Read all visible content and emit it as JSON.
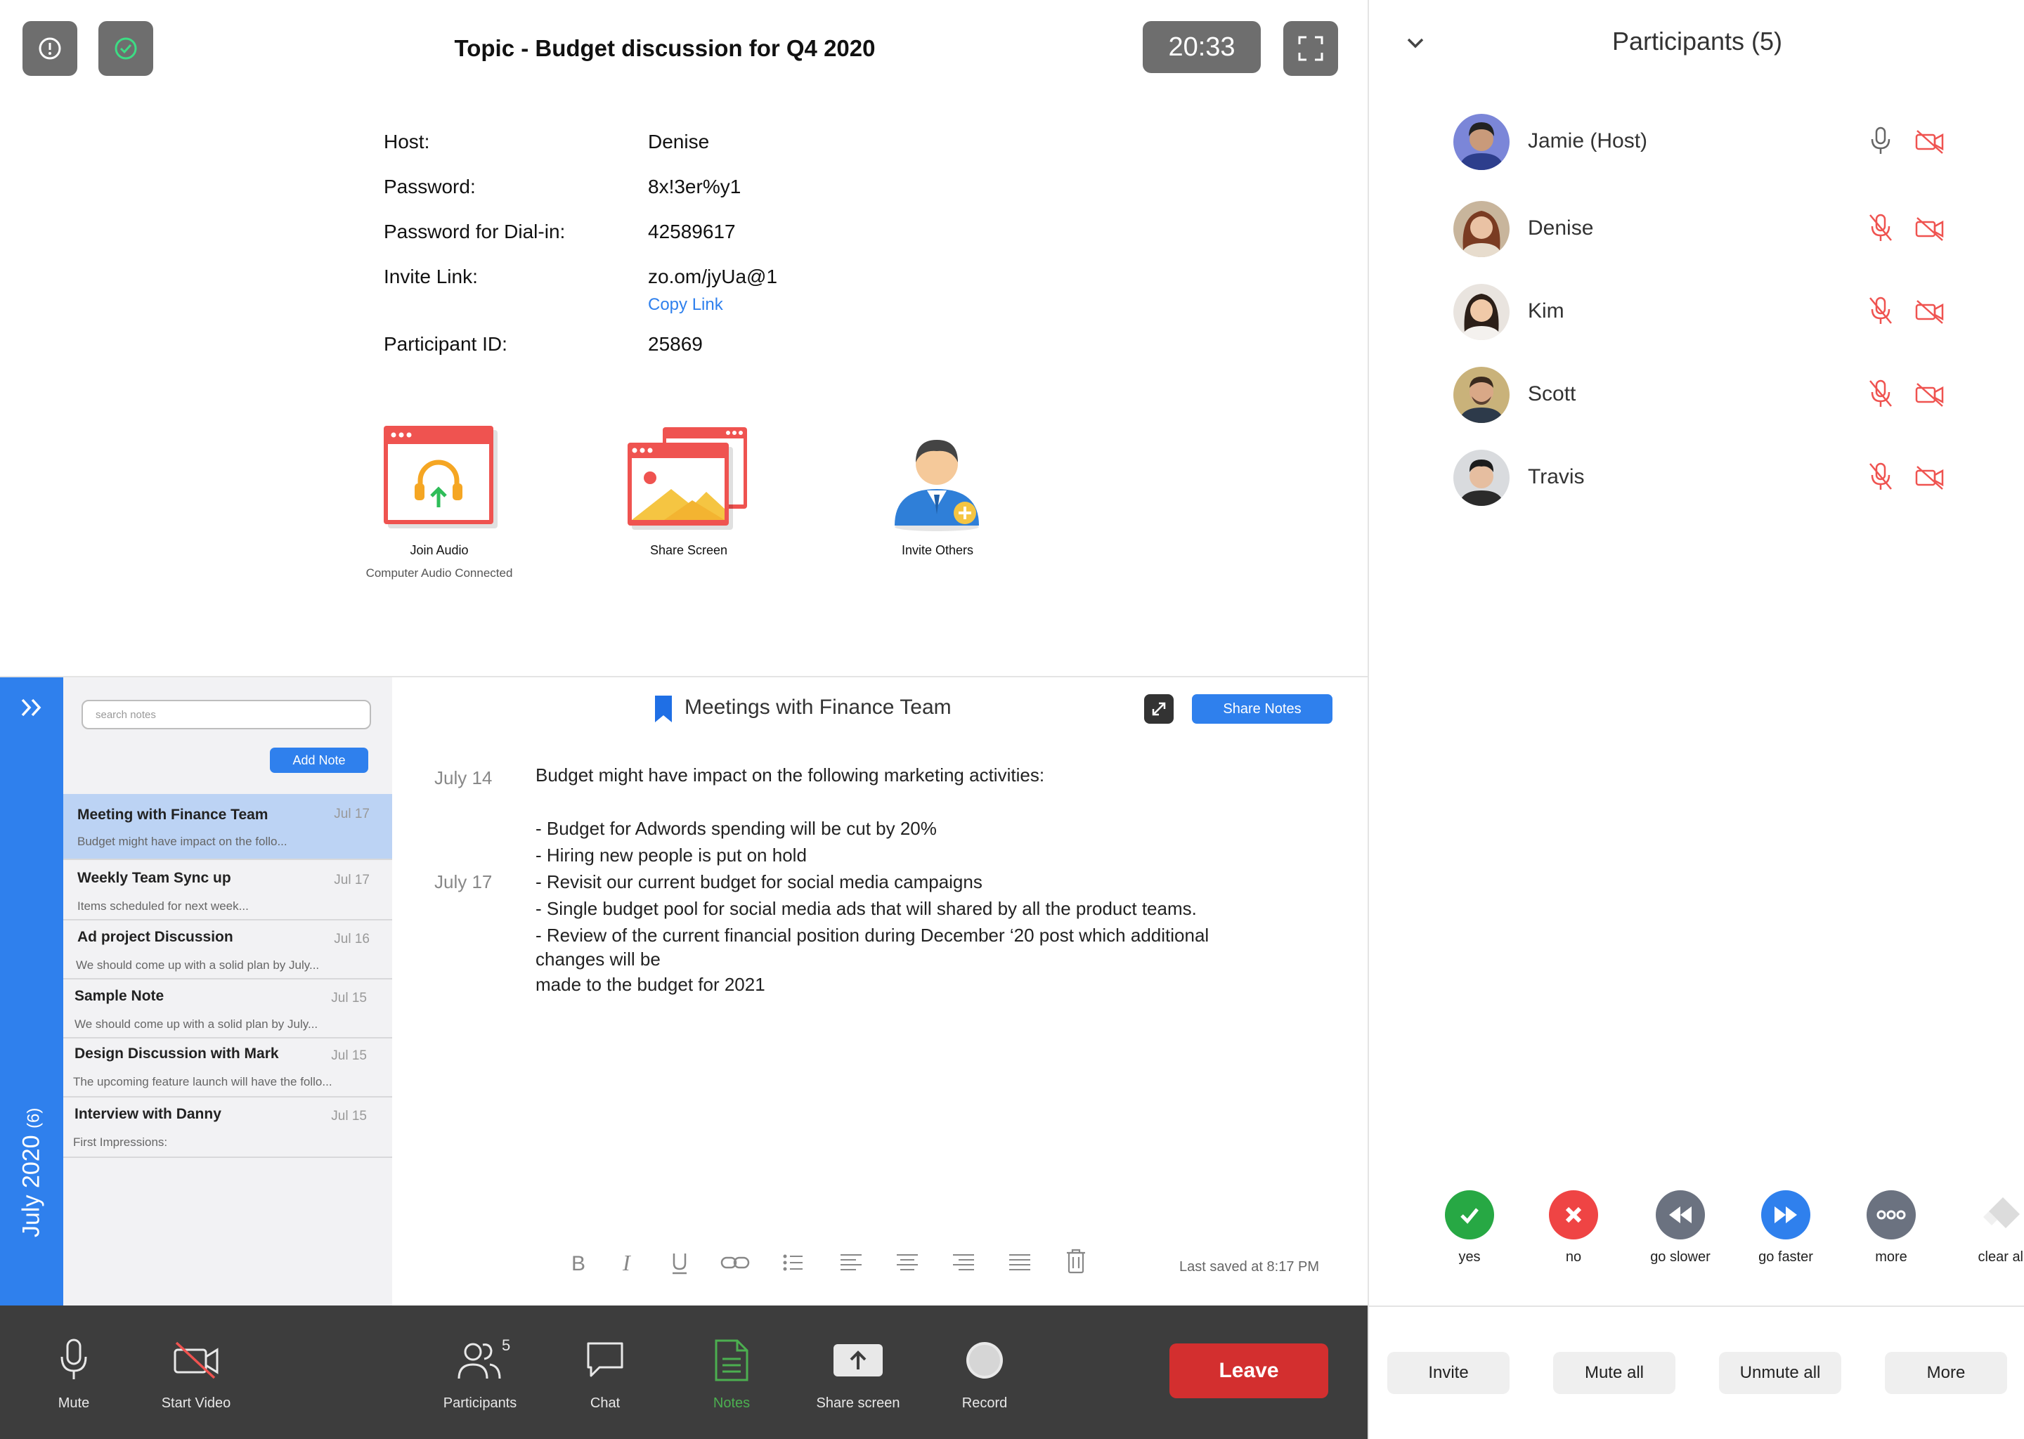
{
  "meeting": {
    "topic": "Topic - Budget discussion for Q4 2020",
    "timer": "20:33",
    "details": [
      {
        "label": "Host:",
        "value": "Denise"
      },
      {
        "label": "Password:",
        "value": "8x!3er%y1"
      },
      {
        "label": "Password for Dial-in:",
        "value": "42589617"
      },
      {
        "label": "Invite Link:",
        "value": "zo.om/jyUa@1"
      },
      {
        "label": "Participant ID:",
        "value": "25869"
      }
    ],
    "copy_link": "Copy Link",
    "actions": {
      "join_audio": {
        "label": "Join Audio",
        "sub": "Computer Audio Connected"
      },
      "share_screen": {
        "label": "Share Screen"
      },
      "invite_others": {
        "label": "Invite Others"
      }
    }
  },
  "participants": {
    "header": "Participants (5)",
    "list": [
      {
        "name": "Jamie (Host)",
        "mic": "on",
        "camera": "off"
      },
      {
        "name": "Denise",
        "mic": "off",
        "camera": "off"
      },
      {
        "name": "Kim",
        "mic": "off",
        "camera": "off"
      },
      {
        "name": "Scott",
        "mic": "off",
        "camera": "off"
      },
      {
        "name": "Travis",
        "mic": "off",
        "camera": "off"
      }
    ],
    "reactions": [
      {
        "label": "yes",
        "icon": "check-icon",
        "color": "#27a844"
      },
      {
        "label": "no",
        "icon": "x-icon",
        "color": "#ef4444"
      },
      {
        "label": "go slower",
        "icon": "rewind-icon",
        "color": "#6b7280"
      },
      {
        "label": "go faster",
        "icon": "fast-forward-icon",
        "color": "#2f80ed"
      },
      {
        "label": "more",
        "icon": "more-icon",
        "color": "#6b7280"
      },
      {
        "label": "clear all",
        "icon": "eraser-icon",
        "color": "#d1d5db"
      }
    ],
    "buttons": [
      "Invite",
      "Mute all",
      "Unmute all",
      "More"
    ]
  },
  "notes": {
    "sidebar_label": "July 2020",
    "sidebar_count": "(6)",
    "search_placeholder": "search notes",
    "add_note": "Add Note",
    "items": [
      {
        "title": "Meeting with Finance Team",
        "date": "Jul 17",
        "preview": "Budget might have impact on the follo..."
      },
      {
        "title": "Weekly Team Sync up",
        "date": "Jul 17",
        "preview": "Items scheduled for next week..."
      },
      {
        "title": "Ad project Discussion",
        "date": "Jul 16",
        "preview": "We should come up with a solid plan by July..."
      },
      {
        "title": "Sample Note",
        "date": "Jul 15",
        "preview": "We should come up with a solid plan by July..."
      },
      {
        "title": "Design Discussion with Mark",
        "date": "Jul 15",
        "preview": "The upcoming feature launch will have the follo..."
      },
      {
        "title": "Interview with Danny",
        "date": "Jul 15",
        "preview": "First Impressions:"
      }
    ],
    "editor": {
      "title": "Meetings with Finance Team",
      "share_notes": "Share Notes",
      "dates": [
        "July 14",
        "July 17"
      ],
      "lines": [
        "Budget might have impact on the following marketing activities:",
        "- Budget for Adwords spending will be cut by 20%",
        "- Hiring new people is put on hold",
        "- Revisit our current budget for social media campaigns",
        "- Single budget pool for social media ads that will shared by all the product teams.",
        "- Review of the current financial position during December ‘20 post which additional",
        "changes will be",
        "made to the budget for 2021"
      ],
      "last_saved": "Last saved at 8:17 PM"
    }
  },
  "toolbar": {
    "mute": "Mute",
    "start_video": "Start Video",
    "participants": "Participants",
    "participants_count": "5",
    "chat": "Chat",
    "notes": "Notes",
    "share_screen": "Share screen",
    "record": "Record",
    "leave": "Leave"
  },
  "colors": {
    "accent": "#2f80ed",
    "leave": "#d32f2f",
    "notes_active": "#4caf50",
    "muted_red": "#ef5350"
  }
}
